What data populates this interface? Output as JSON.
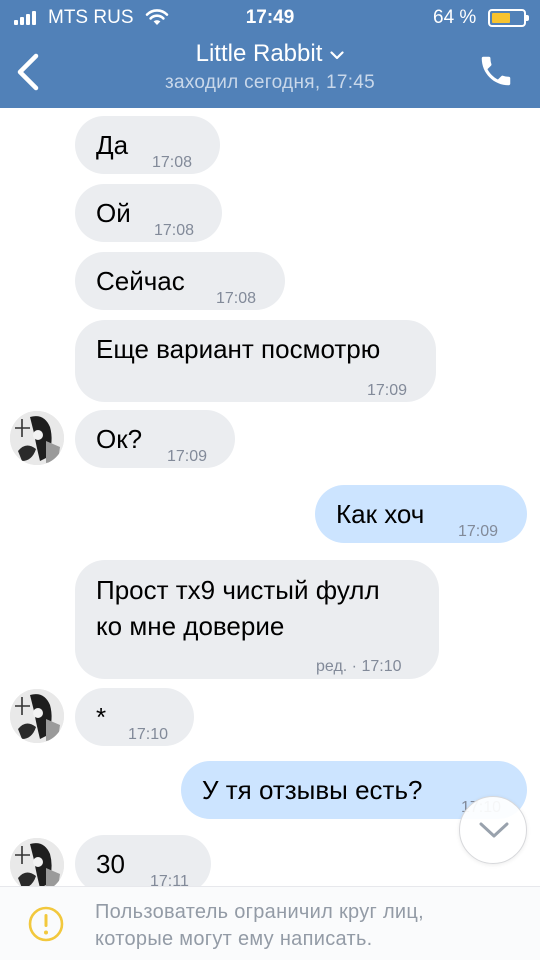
{
  "status_bar": {
    "carrier": "MTS RUS",
    "time": "17:49",
    "battery_percent": "64 %",
    "battery_level": 0.64
  },
  "header": {
    "title": "Little Rabbit",
    "subtitle": "заходил сегодня, 17:45"
  },
  "colors": {
    "header_bg": "#5181b8",
    "incoming_bubble": "#ebedf0",
    "outgoing_bubble": "#cce4ff",
    "battery_fill": "#f7c32f",
    "warning": "#f2c83d"
  },
  "messages": [
    {
      "direction": "in",
      "text": "Да",
      "time": "17:08"
    },
    {
      "direction": "in",
      "text": "Ой",
      "time": "17:08"
    },
    {
      "direction": "in",
      "text": "Сейчас",
      "time": "17:08"
    },
    {
      "direction": "in",
      "text": "Еще вариант посмотрю",
      "time": "17:09"
    },
    {
      "direction": "in",
      "text": "Ок?",
      "time": "17:09"
    },
    {
      "direction": "out",
      "text": "Как хоч",
      "time": "17:09"
    },
    {
      "direction": "in",
      "text_line1": "Прост тх9 чистый фулл",
      "text_line2": "ко мне доверие",
      "time": "ред. · 17:10"
    },
    {
      "direction": "in",
      "text": "*",
      "time": "17:10"
    },
    {
      "direction": "out",
      "text": "У тя отзывы есть?",
      "time": "17:10"
    },
    {
      "direction": "in",
      "text": "30",
      "time": "17:11"
    }
  ],
  "notice": {
    "icon": "warning-icon",
    "text_line1": "Пользователь ограничил круг лиц,",
    "text_line2": "которые могут ему написать."
  },
  "icons": {
    "back": "chevron-left-icon",
    "title_menu": "chevron-down-icon",
    "call": "phone-icon",
    "scroll": "scroll-down-icon"
  }
}
